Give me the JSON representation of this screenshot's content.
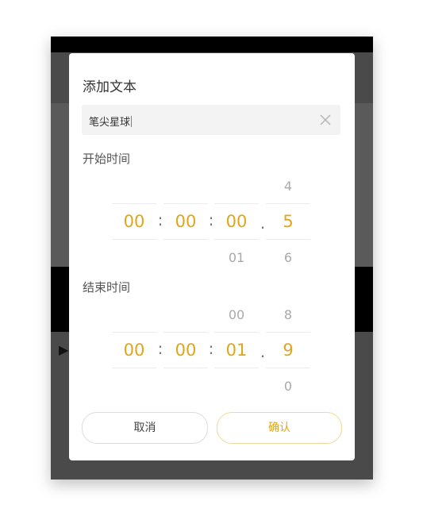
{
  "dialog": {
    "title": "添加文本",
    "text_input": {
      "value": "笔尖星球"
    },
    "start": {
      "label": "开始时间",
      "hours": {
        "value": "00"
      },
      "minutes": {
        "value": "00"
      },
      "seconds": {
        "value": "00",
        "below": "01"
      },
      "fraction": {
        "value": "5",
        "above": "4",
        "below": "6"
      }
    },
    "end": {
      "label": "结束时间",
      "hours": {
        "value": "00"
      },
      "minutes": {
        "value": "00"
      },
      "seconds": {
        "value": "01",
        "above": "00"
      },
      "fraction": {
        "value": "9",
        "above": "8",
        "below": "0"
      }
    },
    "separators": {
      "colon": ":",
      "dot": "."
    },
    "buttons": {
      "cancel": "取消",
      "confirm": "确认"
    }
  },
  "colors": {
    "accent": "#e0a61a",
    "muted": "#a9a9a9"
  }
}
